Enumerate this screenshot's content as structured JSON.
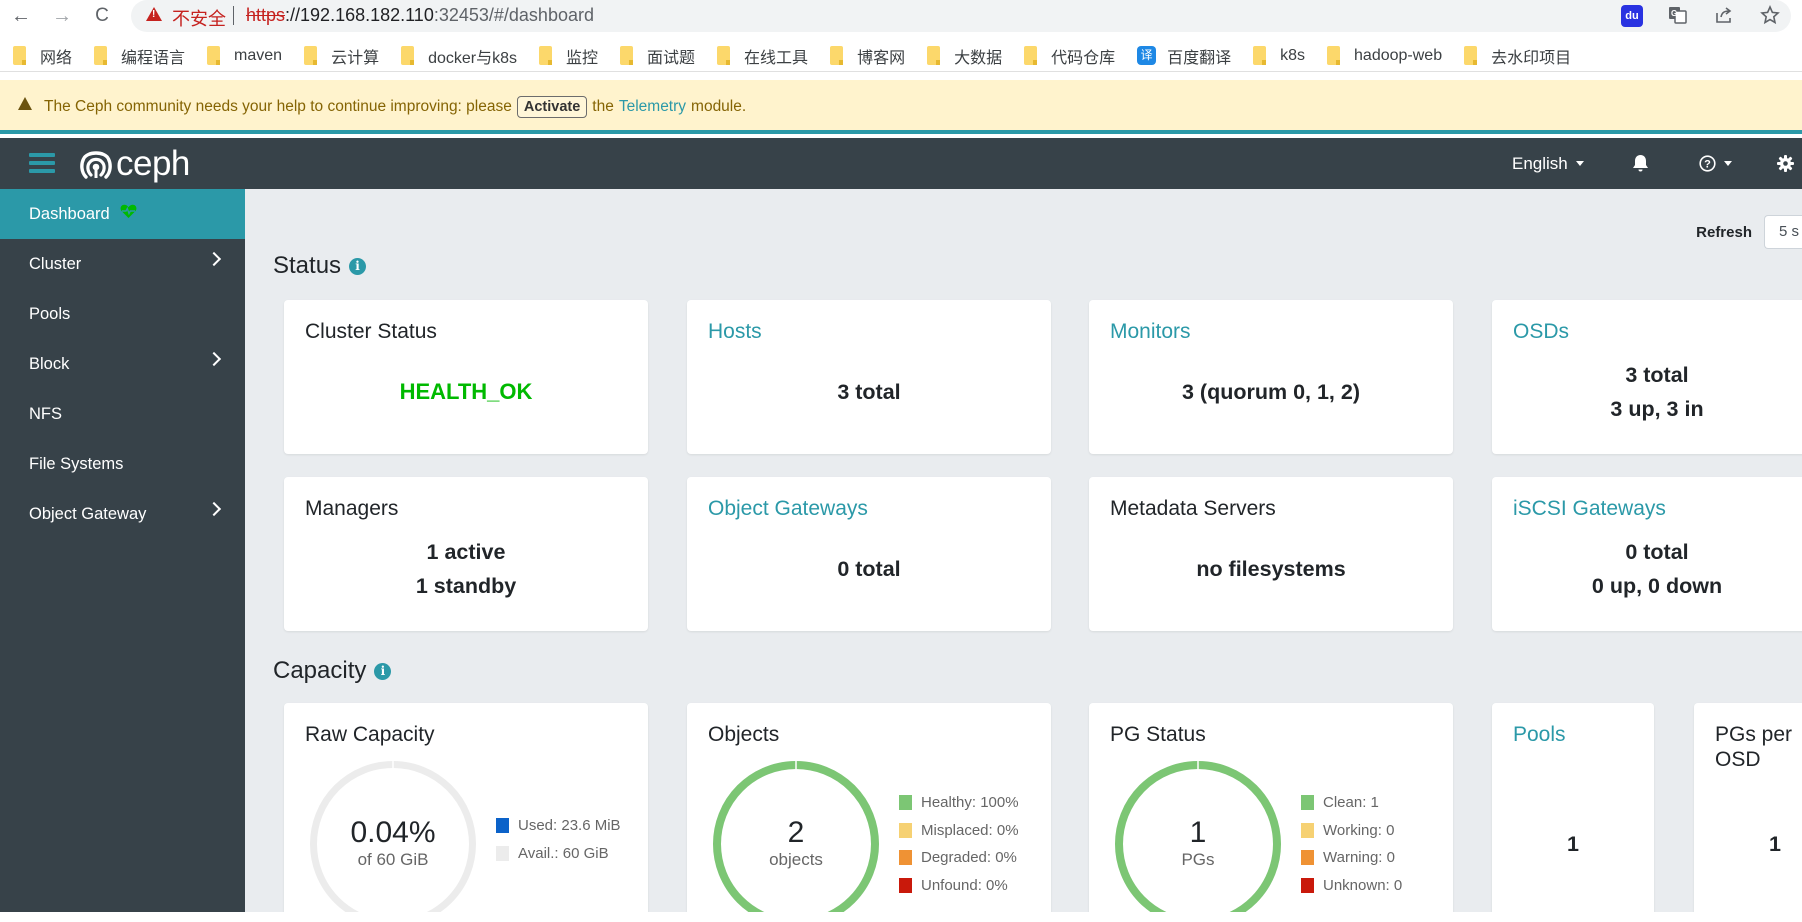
{
  "browser": {
    "nav": {
      "back": "←",
      "forward": "→",
      "reload": "C"
    },
    "insecure_label": "不安全",
    "url": {
      "scheme": "https",
      "host": "://192.168.182.110",
      "rest": ":32453/#/dashboard"
    },
    "omni_icons": [
      "baidu-icon",
      "translate-icon",
      "share-icon",
      "bookmark-star-icon"
    ],
    "bookmarks": [
      {
        "label": "网络",
        "icon": "folder"
      },
      {
        "label": "编程语言",
        "icon": "folder"
      },
      {
        "label": "maven",
        "icon": "folder"
      },
      {
        "label": "云计算",
        "icon": "folder"
      },
      {
        "label": "docker与k8s",
        "icon": "folder"
      },
      {
        "label": "监控",
        "icon": "folder"
      },
      {
        "label": "面试题",
        "icon": "folder"
      },
      {
        "label": "在线工具",
        "icon": "folder"
      },
      {
        "label": "博客网",
        "icon": "folder"
      },
      {
        "label": "大数据",
        "icon": "folder"
      },
      {
        "label": "代码仓库",
        "icon": "folder"
      },
      {
        "label": "百度翻译",
        "icon": "fanyi",
        "badge": "译"
      },
      {
        "label": "k8s",
        "icon": "folder"
      },
      {
        "label": "hadoop-web",
        "icon": "folder"
      },
      {
        "label": "去水印项目",
        "icon": "folder"
      }
    ]
  },
  "banner": {
    "text_before": "The Ceph community needs your help to continue improving: please",
    "activate_label": "Activate",
    "text_mid": "the",
    "link_label": "Telemetry",
    "text_after": "module."
  },
  "navbar": {
    "brand": "ceph",
    "language": "English"
  },
  "sidebar": {
    "items": [
      {
        "label": "Dashboard",
        "active": true,
        "status_icon": "heart-pulse"
      },
      {
        "label": "Cluster",
        "has_children": true
      },
      {
        "label": "Pools"
      },
      {
        "label": "Block",
        "has_children": true
      },
      {
        "label": "NFS"
      },
      {
        "label": "File Systems"
      },
      {
        "label": "Object Gateway",
        "has_children": true
      }
    ]
  },
  "toolbar": {
    "refresh_label": "Refresh",
    "refresh_value": "5 s"
  },
  "status": {
    "title": "Status",
    "cards": [
      {
        "title": "Cluster Status",
        "link": false,
        "lines": [
          "HEALTH_OK"
        ]
      },
      {
        "title": "Hosts",
        "link": true,
        "lines": [
          "3 total"
        ]
      },
      {
        "title": "Monitors",
        "link": true,
        "lines": [
          "3 (quorum 0, 1, 2)"
        ]
      },
      {
        "title": "OSDs",
        "link": true,
        "lines": [
          "3 total",
          "3 up, 3 in"
        ]
      },
      {
        "title": "Managers",
        "link": false,
        "lines": [
          "1 active",
          "1 standby"
        ]
      },
      {
        "title": "Object Gateways",
        "link": true,
        "lines": [
          "0 total"
        ]
      },
      {
        "title": "Metadata Servers",
        "link": false,
        "lines": [
          "no filesystems"
        ]
      },
      {
        "title": "iSCSI Gateways",
        "link": true,
        "lines": [
          "0 total",
          "0 up, 0 down"
        ]
      }
    ]
  },
  "capacity": {
    "title": "Capacity",
    "raw": {
      "title": "Raw Capacity",
      "percent_label": "0.04%",
      "of_label": "of 60 GiB",
      "used_fraction": 0.0004,
      "legend": [
        {
          "label": "Used: 23.6 MiB",
          "color": "#0b62c9"
        },
        {
          "label": "Avail.: 60 GiB",
          "color": "#ececec"
        }
      ]
    },
    "objects": {
      "title": "Objects",
      "count": "2",
      "unit": "objects",
      "legend": [
        {
          "label": "Healthy: 100%",
          "color": "#7cc674"
        },
        {
          "label": "Misplaced: 0%",
          "color": "#f6d173"
        },
        {
          "label": "Degraded: 0%",
          "color": "#ef9234"
        },
        {
          "label": "Unfound: 0%",
          "color": "#c9190b"
        }
      ]
    },
    "pg_status": {
      "title": "PG Status",
      "count": "1",
      "unit": "PGs",
      "legend": [
        {
          "label": "Clean: 1",
          "color": "#7cc674"
        },
        {
          "label": "Working: 0",
          "color": "#f6d173"
        },
        {
          "label": "Warning: 0",
          "color": "#ef9234"
        },
        {
          "label": "Unknown: 0",
          "color": "#c9190b"
        }
      ]
    },
    "pools": {
      "title": "Pools",
      "value": "1"
    },
    "pgs_per_osd": {
      "title": "PGs per OSD",
      "value": "1"
    }
  },
  "colors": {
    "accent": "#2b99a8",
    "navbar": "#374249",
    "health_ok": "#00b900",
    "donut_healthy": "#7cc674",
    "donut_empty": "#ececec"
  }
}
